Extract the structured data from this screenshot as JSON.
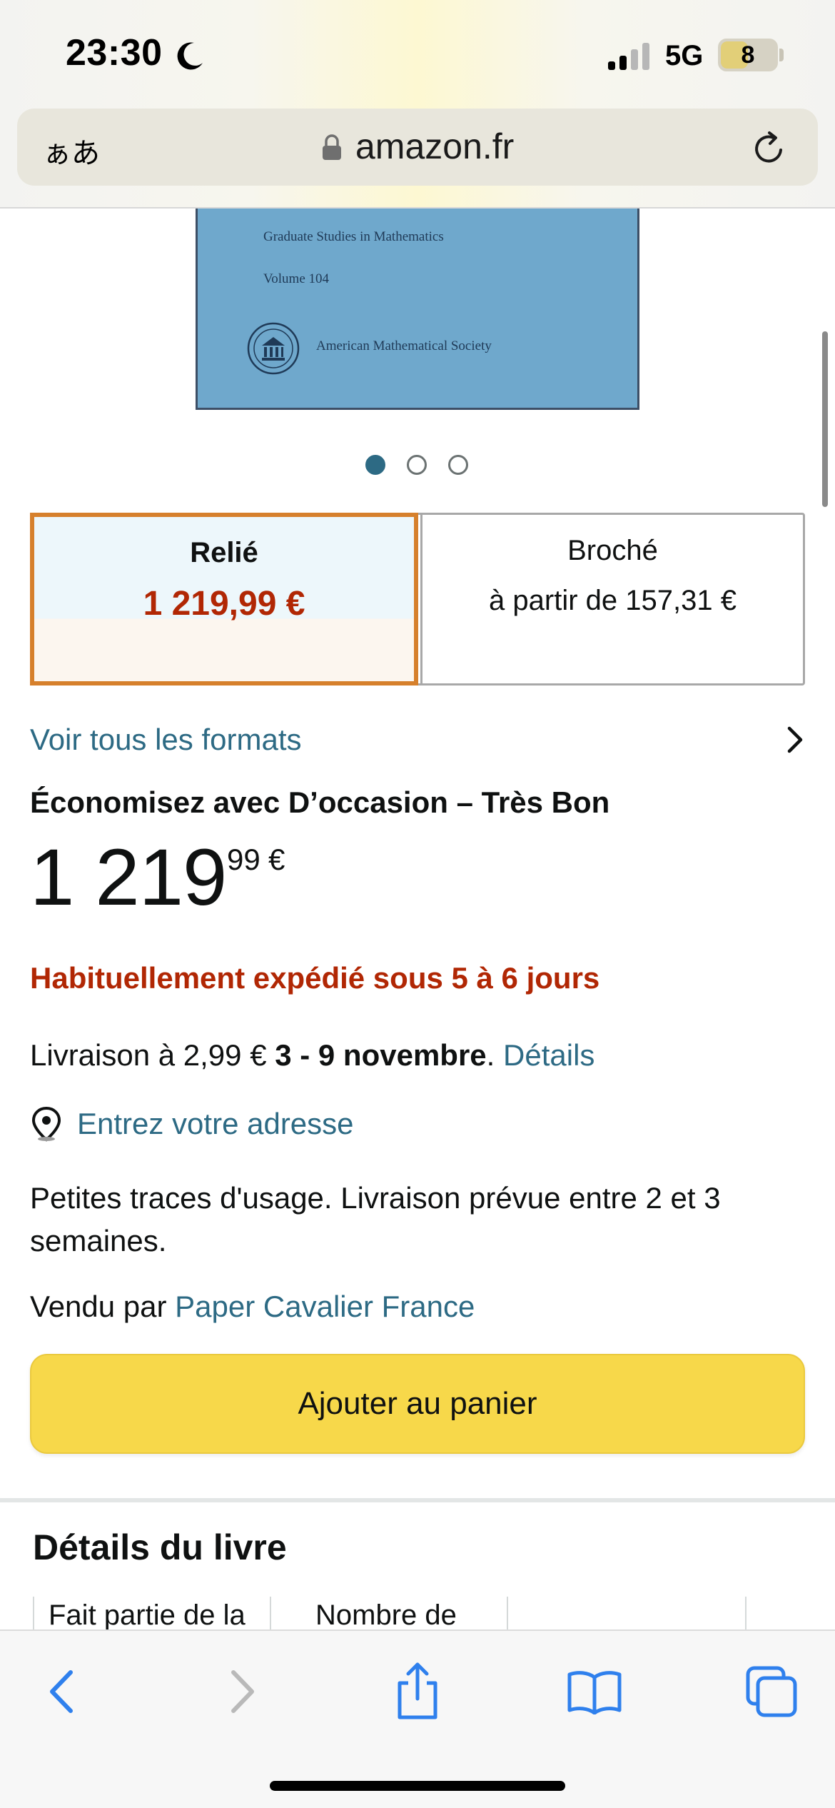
{
  "status_bar": {
    "time": "23:30",
    "network": "5G",
    "battery": "8"
  },
  "browser": {
    "text_size_label": "ぁあ",
    "domain": "amazon.fr"
  },
  "cover": {
    "series": "Graduate Studies in Mathematics",
    "volume": "Volume 104",
    "publisher": "American Mathematical Society"
  },
  "formats": {
    "hardcover": {
      "name": "Relié",
      "price": "1 219,99 €"
    },
    "paperback": {
      "name": "Broché",
      "price": "à partir de 157,31 €"
    },
    "see_all": "Voir tous les formats"
  },
  "offer": {
    "heading": "Économisez avec D’occasion – Très Bon",
    "price_whole": "1 219",
    "price_fraction": "99",
    "currency": "€",
    "availability": "Habituellement expédié sous 5 à 6 jours",
    "delivery_prefix": "Livraison à 2,99 € ",
    "delivery_dates": "3 - 9 novembre",
    "delivery_period": ".",
    "delivery_details_link": "Détails",
    "enter_address": "Entrez votre adresse",
    "condition_note": "Petites traces d'usage. Livraison prévue entre 2 et 3 semaines.",
    "sold_by_prefix": "Vendu par ",
    "seller": "Paper Cavalier France",
    "add_to_cart": "Ajouter au panier"
  },
  "book_details": {
    "heading": "Détails du livre",
    "cards": [
      "Fait partie de la",
      "Nombre de"
    ]
  },
  "colors": {
    "link": "#2d6a84",
    "price_red": "#b12704",
    "selected_border": "#d6802c",
    "cart_button": "#f7d84a",
    "ios_blue": "#2f80ed"
  }
}
